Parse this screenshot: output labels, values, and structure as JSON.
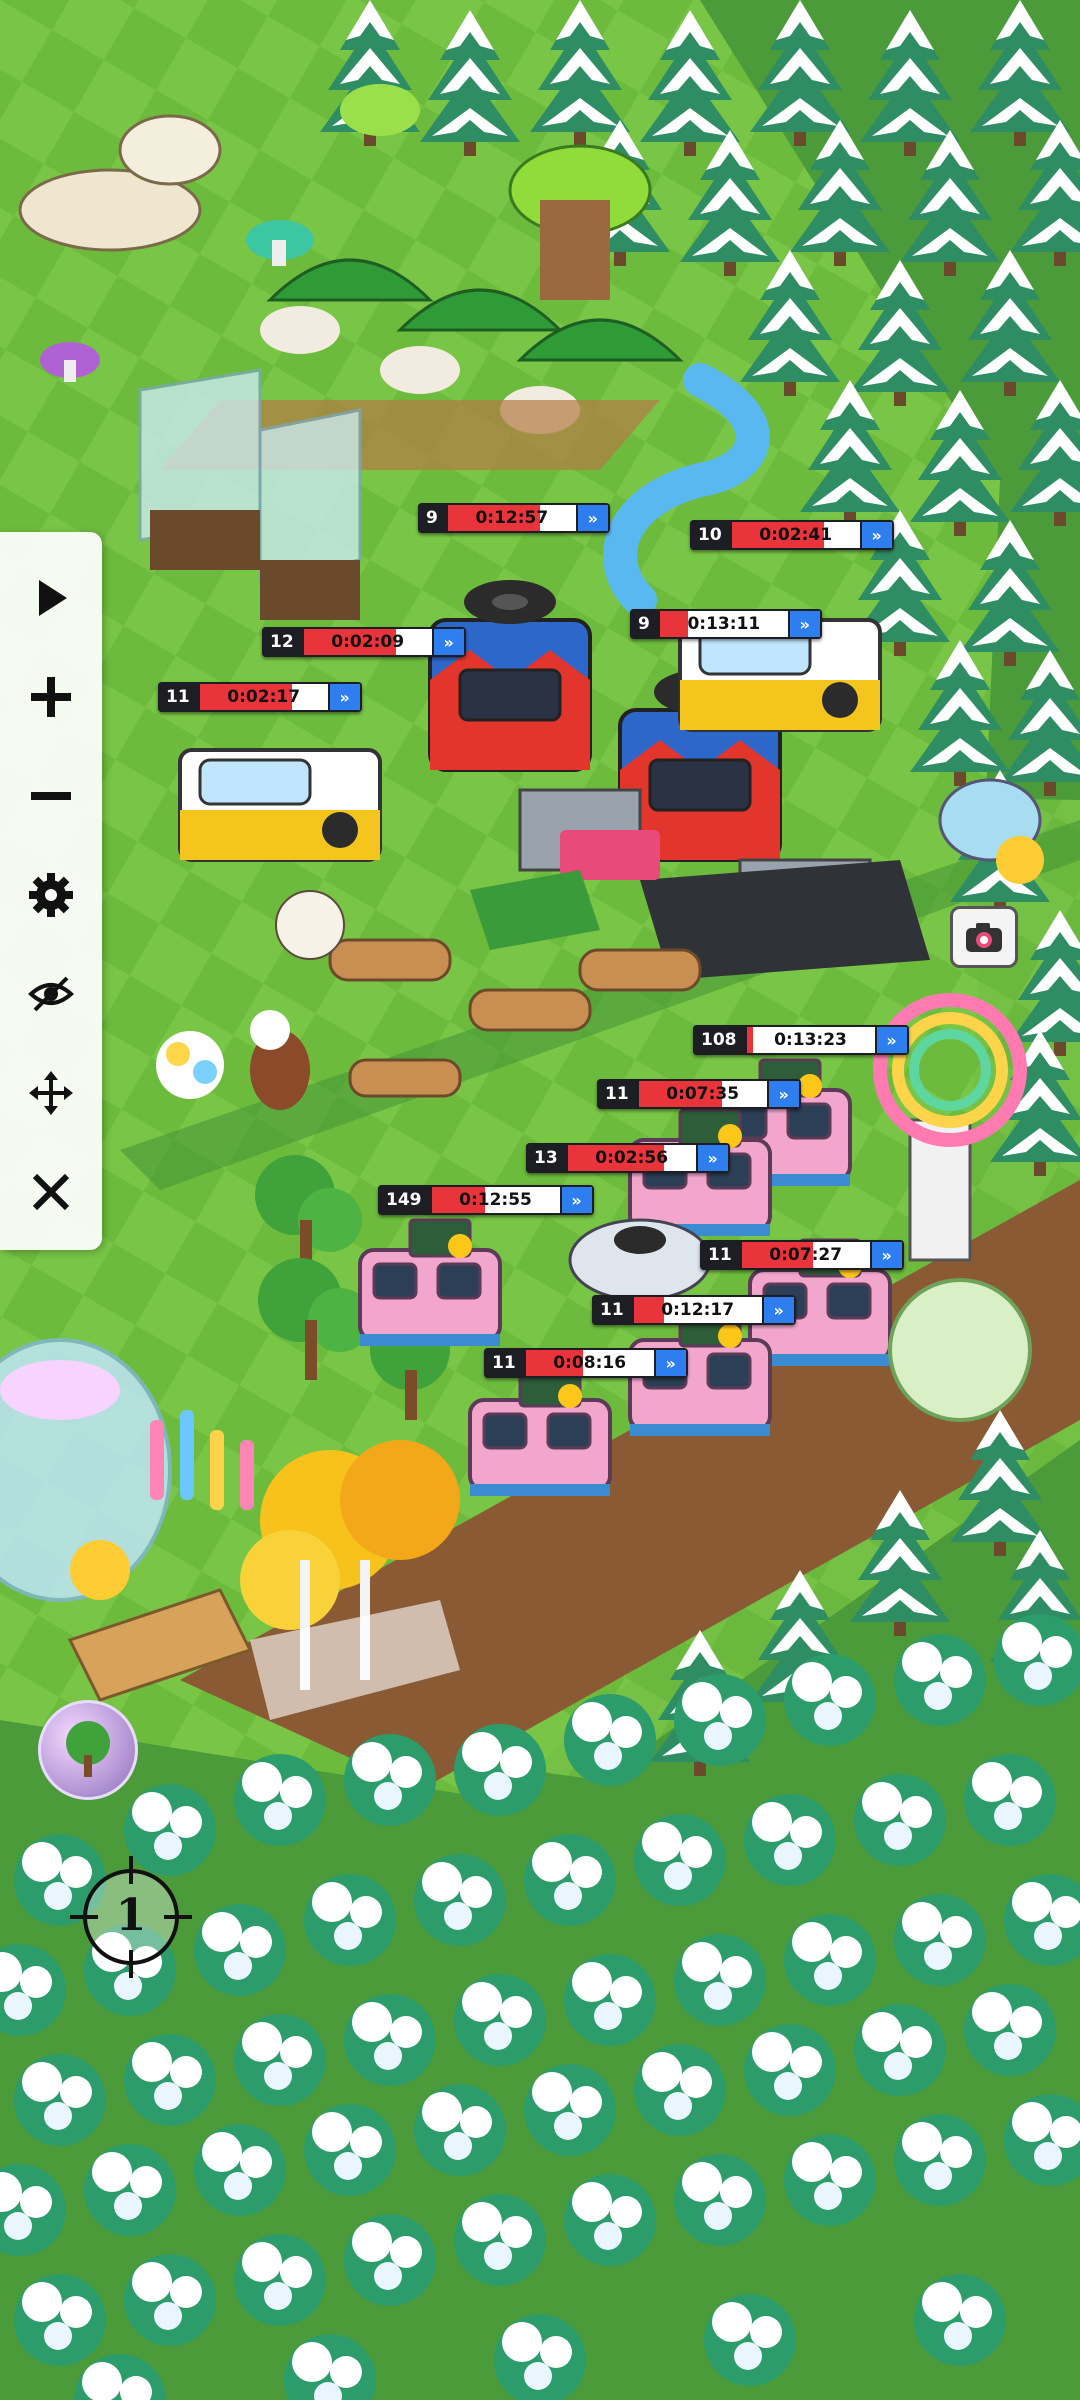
{
  "timers": [
    {
      "id": "t1",
      "level": "9",
      "time": "0:12:57",
      "progress": 0.72
    },
    {
      "id": "t2",
      "level": "10",
      "time": "0:02:41",
      "progress": 0.72
    },
    {
      "id": "t3",
      "level": "9",
      "time": "0:13:11",
      "progress": 0.22
    },
    {
      "id": "t4",
      "level": "12",
      "time": "0:02:09",
      "progress": 0.72
    },
    {
      "id": "t5",
      "level": "11",
      "time": "0:02:17",
      "progress": 0.72
    },
    {
      "id": "t6",
      "level": "108",
      "time": "0:13:23",
      "progress": 0.05
    },
    {
      "id": "t7",
      "level": "11",
      "time": "0:07:35",
      "progress": 0.65
    },
    {
      "id": "t8",
      "level": "13",
      "time": "0:02:56",
      "progress": 0.75
    },
    {
      "id": "t9",
      "level": "149",
      "time": "0:12:55",
      "progress": 0.42
    },
    {
      "id": "t10",
      "level": "11",
      "time": "0:07:27",
      "progress": 0.56
    },
    {
      "id": "t11",
      "level": "11",
      "time": "0:12:17",
      "progress": 0.24
    },
    {
      "id": "t12",
      "level": "11",
      "time": "0:08:16",
      "progress": 0.45
    }
  ],
  "toolbar": {
    "tools": [
      "play-icon",
      "plus-icon",
      "minus-icon",
      "gear-icon",
      "eye-off-icon",
      "move-icon",
      "close-icon"
    ]
  },
  "crosshair": {
    "label": "1"
  },
  "colors": {
    "grass": "#5fae3a",
    "timer_fill": "#e8343a",
    "skip_button": "#2e7ef0",
    "pine_snow": "#ffffff",
    "pine_green": "#2f9a6a"
  }
}
